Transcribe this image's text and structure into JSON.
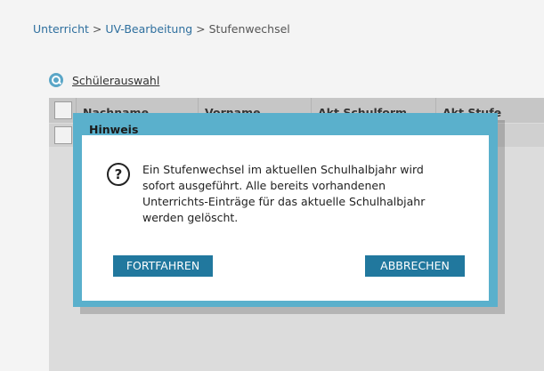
{
  "breadcrumb": {
    "part1": "Unterricht",
    "sep1": " > ",
    "part2": "UV-Bearbeitung",
    "sep2": " > ",
    "current": "Stufenwechsel"
  },
  "selector": {
    "icon": "search-icon",
    "label": "Schülerauswahl"
  },
  "table": {
    "columns": [
      "Nachname",
      "Vorname",
      "Akt Schulform",
      "Akt Stufe"
    ]
  },
  "dialog": {
    "title": "Hinweis",
    "icon": "question-icon",
    "icon_glyph": "?",
    "message": "Ein Stufenwechsel im aktuellen Schulhalbjahr wird\nsofort ausgeführt. Alle bereits vorhandenen\nUnterrichts-Einträge für das aktuelle Schulhalbjahr\nwerden gelöscht.",
    "continue_label": "FORTFAHREN",
    "cancel_label": "ABBRECHEN"
  },
  "colors": {
    "accent": "#21789e",
    "overlay_frame": "#5ab0cc",
    "link": "#2e6f9e"
  }
}
